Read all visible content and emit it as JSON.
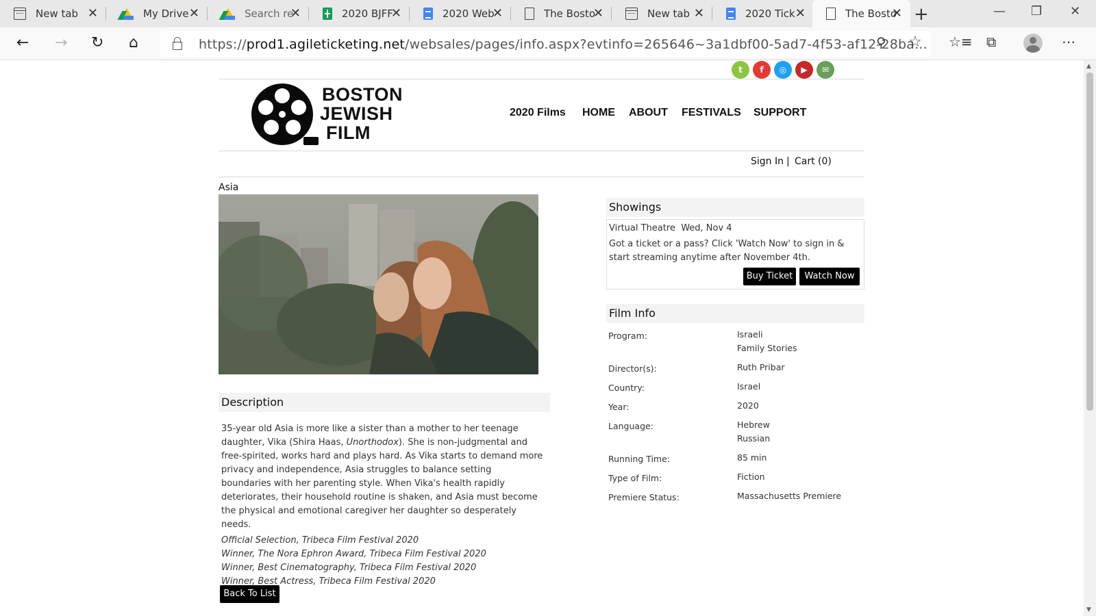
{
  "browser": {
    "tabs": [
      {
        "title": "New tab",
        "icon": "window-icon"
      },
      {
        "title": "My Drive",
        "icon": "google-drive-icon"
      },
      {
        "title": "Search re",
        "icon": "google-drive-icon"
      },
      {
        "title": "2020 BJFF",
        "icon": "google-sheets-icon"
      },
      {
        "title": "2020 Web",
        "icon": "google-docs-icon"
      },
      {
        "title": "The Bosto",
        "icon": "page-icon"
      },
      {
        "title": "New tab",
        "icon": "window-icon"
      },
      {
        "title": "2020 Tick",
        "icon": "google-docs-icon"
      },
      {
        "title": "The Bosto",
        "icon": "page-icon",
        "active": true
      }
    ],
    "address": {
      "scheme": "https://",
      "host": "prod1.agileticketing.net",
      "path": "/websales/pages/info.aspx?evtinfo=265646~3a1dbf00-5ad7-4f53-af12-28ba..."
    }
  },
  "site": {
    "social": [
      {
        "name": "twitter-icon",
        "glyph": "t",
        "color": "#8cc63f"
      },
      {
        "name": "facebook-icon",
        "glyph": "f",
        "color": "#e53935"
      },
      {
        "name": "instagram-icon",
        "glyph": "◎",
        "color": "#1da1f2"
      },
      {
        "name": "youtube-icon",
        "glyph": "▶",
        "color": "#c62828"
      },
      {
        "name": "email-icon",
        "glyph": "✉",
        "color": "#6a9e5b"
      }
    ],
    "logo": {
      "line1": "BOSTON",
      "line2": "JEWISH",
      "line3": "FILM"
    },
    "nav": [
      "2020 Films",
      "HOME",
      "ABOUT",
      "FESTIVALS",
      "SUPPORT"
    ],
    "account": {
      "signin": "Sign In",
      "separator": "|",
      "cart": "Cart (0)"
    }
  },
  "film": {
    "title": "Asia",
    "description_heading": "Description",
    "description_parts": [
      "35-year old Asia is more like a sister than a mother to her teenage daughter, Vika (Shira Haas, ",
      "Unorthodox",
      "). She is non-judgmental and free-spirited, works hard and plays hard. As Vika starts to demand more privacy and independence, Asia struggles to balance setting boundaries with her parenting style. When Vika's health rapidly deteriorates, their household routine is shaken, and Asia must become the physical and emotional caregiver her daughter so desperately needs."
    ],
    "accolades": [
      "Official Selection, Tribeca Film Festival 2020",
      "Winner, The Nora Ephron Award, Tribeca Film Festival 2020",
      "Winner, Best Cinematography, Tribeca Film Festival 2020",
      "Winner, Best Actress, Tribeca Film Festival 2020"
    ],
    "back_label": "Back To List",
    "showings": {
      "heading": "Showings",
      "venue": "Virtual Theatre",
      "date": "Wed, Nov 4",
      "note": "Got a ticket or a pass? Click 'Watch Now' to sign in & start streaming anytime after November 4th.",
      "buy_label": "Buy Ticket",
      "watch_label": "Watch Now"
    },
    "info": {
      "heading": "Film Info",
      "rows": [
        {
          "label": "Program:",
          "values": [
            "Israeli",
            "Family Stories"
          ]
        },
        {
          "label": "Director(s):",
          "values": [
            "Ruth Pribar"
          ]
        },
        {
          "label": "Country:",
          "values": [
            "Israel"
          ]
        },
        {
          "label": "Year:",
          "values": [
            "2020"
          ]
        },
        {
          "label": "Language:",
          "values": [
            "Hebrew",
            "Russian"
          ]
        },
        {
          "label": "Running Time:",
          "values": [
            "85 min"
          ]
        },
        {
          "label": "Type of Film:",
          "values": [
            "Fiction"
          ]
        },
        {
          "label": "Premiere Status:",
          "values": [
            "Massachusetts Premiere"
          ]
        }
      ]
    }
  }
}
